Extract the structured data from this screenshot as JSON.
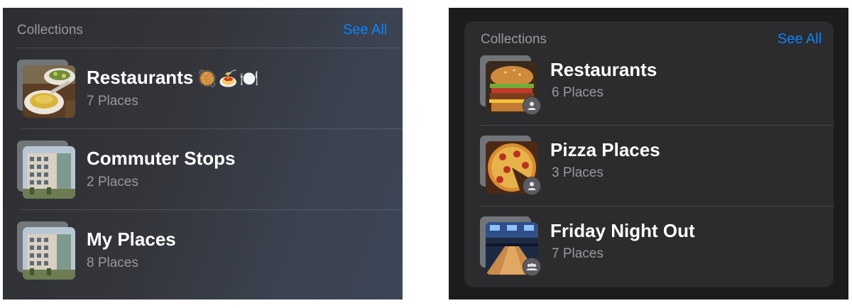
{
  "left_panel": {
    "header": {
      "title": "Collections",
      "see_all": "See All"
    },
    "rows": [
      {
        "name": "Restaurants",
        "emoji": "🥘🍝🍽️",
        "count": "7 Places",
        "thumb_icon": "soup-food-icon"
      },
      {
        "name": "Commuter Stops",
        "emoji": "",
        "count": "2 Places",
        "thumb_icon": "building-icon"
      },
      {
        "name": "My Places",
        "emoji": "",
        "count": "8 Places",
        "thumb_icon": "building-icon"
      }
    ]
  },
  "right_panel": {
    "header": {
      "title": "Collections",
      "see_all": "See All"
    },
    "rows": [
      {
        "name": "Restaurants",
        "count": "6 Places",
        "thumb_icon": "burger-icon",
        "badge_icon": "person-icon"
      },
      {
        "name": "Pizza Places",
        "count": "3 Places",
        "thumb_icon": "pizza-icon",
        "badge_icon": "person-icon"
      },
      {
        "name": "Friday Night Out",
        "count": "7 Places",
        "thumb_icon": "bowling-alley-icon",
        "badge_icon": "group-icon"
      }
    ]
  },
  "colors": {
    "accent": "#0a84ff",
    "secondary_text": "#98989e",
    "primary_text": "#ffffff"
  }
}
